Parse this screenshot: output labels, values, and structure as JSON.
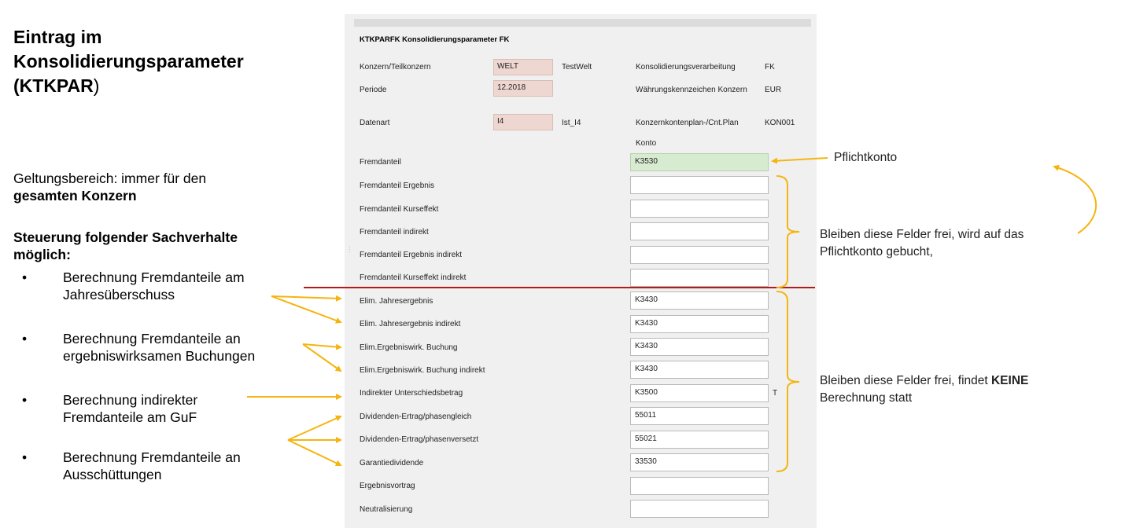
{
  "slide": {
    "title_line1": "Eintrag im",
    "title_line2": "Konsolidierungsparameter",
    "title_line3_bold": "(KTKPAR",
    "title_line3_rest": ")",
    "scope_prefix": "Geltungsbereich: immer für den",
    "scope_bold": "gesamten Konzern",
    "steering_heading_line1": "Steuerung folgender Sachverhalte",
    "steering_heading_line2": "möglich:",
    "bullet_symbol": "•",
    "bullets": [
      {
        "line1": "Berechnung Fremdanteile am",
        "line2": "Jahresüberschuss"
      },
      {
        "line1": "Berechnung Fremdanteile an",
        "line2": "ergebniswirksamen Buchungen"
      },
      {
        "line1": "Berechnung indirekter",
        "line2": "Fremdanteile am GuF"
      },
      {
        "line1": "Berechnung  Fremdanteile an",
        "line2": "Ausschüttungen"
      }
    ]
  },
  "form": {
    "title": "KTKPARFK Konsolidierungsparameter FK",
    "header": {
      "konzern_label": "Konzern/Teilkonzern",
      "konzern_value": "WELT",
      "konzern_desc": "TestWelt",
      "periode_label": "Periode",
      "periode_value": "12.2018",
      "datenart_label": "Datenart",
      "datenart_value": "I4",
      "datenart_desc": "Ist_I4",
      "kv_label": "Konsolidierungsverarbeitung",
      "kv_value": "FK",
      "wk_label": "Währungskennzeichen Konzern",
      "wk_value": "EUR",
      "kp_label": "Konzernkontenplan-/Cnt.Plan",
      "kp_value": "KON001",
      "konto_header": "Konto"
    },
    "rows": [
      {
        "label": "Fremdanteil",
        "value": "K3530",
        "flag": ""
      },
      {
        "label": "Fremdanteil Ergebnis",
        "value": "",
        "flag": ""
      },
      {
        "label": "Fremdanteil Kurseffekt",
        "value": "",
        "flag": ""
      },
      {
        "label": "Fremdanteil indirekt",
        "value": "",
        "flag": ""
      },
      {
        "label": "Fremdanteil Ergebnis indirekt",
        "value": "",
        "flag": ""
      },
      {
        "label": "Fremdanteil Kurseffekt indirekt",
        "value": "",
        "flag": ""
      },
      {
        "label": "Elim. Jahresergebnis",
        "value": "K3430",
        "flag": ""
      },
      {
        "label": "Elim. Jahresergebnis indirekt",
        "value": "K3430",
        "flag": ""
      },
      {
        "label": "Elim.Ergebniswirk. Buchung",
        "value": "K3430",
        "flag": ""
      },
      {
        "label": "Elim.Ergebniswirk. Buchung indirekt",
        "value": "K3430",
        "flag": ""
      },
      {
        "label": "Indirekter Unterschiedsbetrag",
        "value": "K3500",
        "flag": "T"
      },
      {
        "label": "Dividenden-Ertrag/phasengleich",
        "value": "55011",
        "flag": ""
      },
      {
        "label": "Dividenden-Ertrag/phasenversetzt",
        "value": "55021",
        "flag": ""
      },
      {
        "label": "Garantiedividende",
        "value": "33530",
        "flag": ""
      },
      {
        "label": "Ergebnisvortrag",
        "value": "",
        "flag": ""
      },
      {
        "label": "Neutralisierung",
        "value": "",
        "flag": ""
      }
    ]
  },
  "annotations": {
    "pflichtkonto": "Pflichtkonto",
    "group1_line1": "Bleiben diese Felder frei, wird auf das",
    "group1_line2": "Pflichtkonto gebucht,",
    "group2_line1_prefix": "Bleiben diese Felder frei, findet ",
    "group2_line1_bold": "KEINE",
    "group2_line2": "Berechnung statt"
  },
  "colors": {
    "arrow": "#f5b50f",
    "divider": "#b01c1c",
    "key_field": "#efd7d1",
    "mandatory_field": "#d6ebcf",
    "panel": "#f0f0f0"
  }
}
